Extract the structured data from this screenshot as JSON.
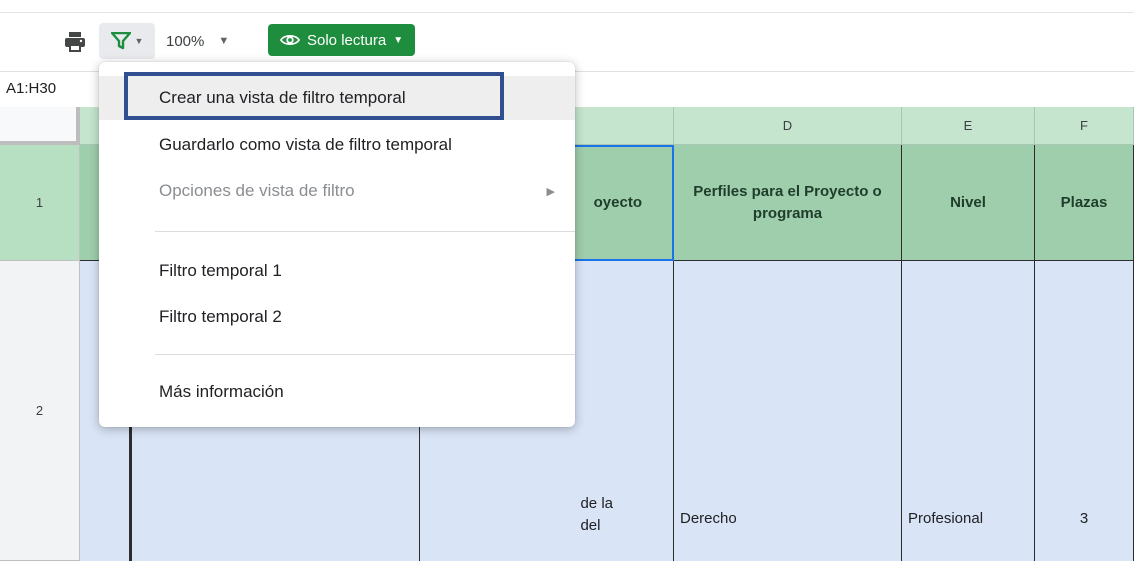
{
  "toolbar": {
    "print_icon": "printer-icon",
    "filter_icon": "filter-funnel-icon",
    "zoom_value": "100%",
    "readonly_label": "Solo lectura",
    "readonly_icon": "eye-icon",
    "filter_color": "#1e8e3e",
    "readonly_color": "#1e8e3e"
  },
  "namebox": {
    "value": "A1:H30"
  },
  "grid": {
    "columns": [
      "D",
      "E",
      "F"
    ],
    "rows": [
      "1",
      "2"
    ],
    "header_row": {
      "c_fragment": "oyecto",
      "d": "Perfiles para el Proyecto o programa",
      "e": "Nivel",
      "f": "Plazas"
    },
    "data_row": {
      "c_fragment_line1": "de la",
      "c_fragment_line2": "del",
      "d": "Derecho",
      "e": "Profesional",
      "f": "3"
    },
    "header_fill": "#9fceac",
    "data_fill": "#d9e4f6"
  },
  "menu": {
    "items": [
      {
        "label": "Crear una vista de filtro temporal"
      },
      {
        "label": "Guardarlo como vista de filtro temporal"
      },
      {
        "label": "Opciones de vista de filtro"
      },
      {
        "label": "Filtro temporal 1"
      },
      {
        "label": "Filtro temporal 2"
      },
      {
        "label": "Más información"
      }
    ]
  }
}
